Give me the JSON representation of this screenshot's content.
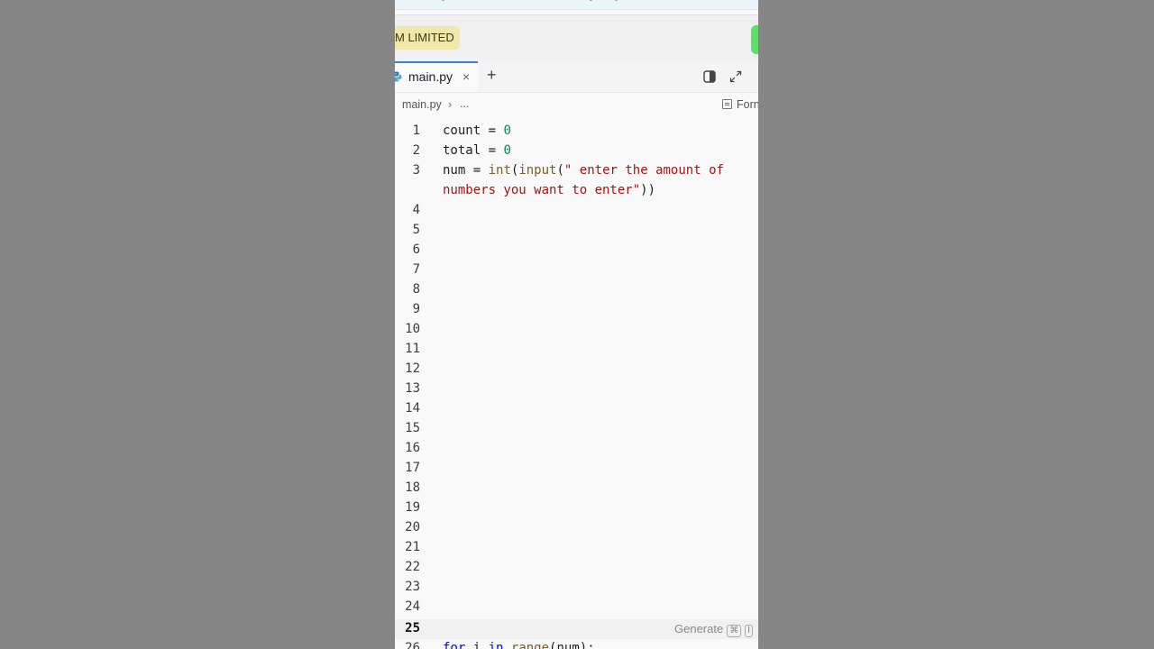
{
  "banner": {
    "company_badge": "M LIMITED"
  },
  "tabs": [
    {
      "label": "main.py",
      "close": "×"
    }
  ],
  "tabbar": {
    "add": "+"
  },
  "breadcrumb": {
    "file": "main.py",
    "separator": "›",
    "more": "..."
  },
  "toolbar": {
    "format_label": "Forn"
  },
  "editor": {
    "line_numbers": [
      "1",
      "2",
      "3",
      "4",
      "5",
      "6",
      "7",
      "8",
      "9",
      "10",
      "11",
      "12",
      "13",
      "14",
      "15",
      "16",
      "17",
      "18",
      "19",
      "20",
      "21",
      "22",
      "23",
      "24",
      "25",
      "26"
    ],
    "active_line": "25",
    "lines": {
      "l1_var": "count",
      "l1_op": " = ",
      "l1_num": "0",
      "l2_var": "total",
      "l2_op": " = ",
      "l2_num": "0",
      "l3_var": "num",
      "l3_op": " = ",
      "l3_fn1": "int",
      "l3_p1": "(",
      "l3_fn2": "input",
      "l3_p2": "(",
      "l3_str": "\" enter the amount of",
      "l3b_str": "numbers you want to enter\"",
      "l3b_close": "))",
      "l26_kw1": "for",
      "l26_var": " i ",
      "l26_kw2": "in",
      "l26_sp": " ",
      "l26_fn": "range",
      "l26_rest": "(num):"
    },
    "generate_hint": "Generate",
    "shortcut_keys": [
      "⌘",
      "I"
    ]
  },
  "colors": {
    "badge_bg": "#efe8a8",
    "tab_accent": "#3b82d6",
    "green_pill": "#5ddf6a",
    "number": "#098658",
    "function": "#795e26",
    "string": "#a31515",
    "keyword": "#0000ff"
  },
  "icons": [
    "python-file-icon",
    "close-icon",
    "plus-icon",
    "split-view-icon",
    "expand-icon",
    "chevron-right-icon",
    "format-icon"
  ]
}
